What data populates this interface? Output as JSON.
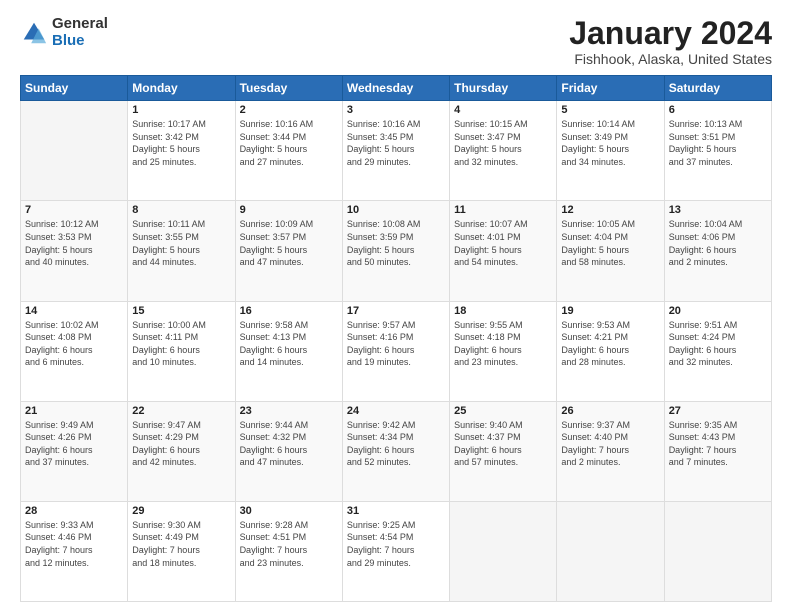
{
  "logo": {
    "general": "General",
    "blue": "Blue"
  },
  "header": {
    "title": "January 2024",
    "subtitle": "Fishhook, Alaska, United States"
  },
  "days_of_week": [
    "Sunday",
    "Monday",
    "Tuesday",
    "Wednesday",
    "Thursday",
    "Friday",
    "Saturday"
  ],
  "weeks": [
    [
      {
        "day": "",
        "info": ""
      },
      {
        "day": "1",
        "info": "Sunrise: 10:17 AM\nSunset: 3:42 PM\nDaylight: 5 hours\nand 25 minutes."
      },
      {
        "day": "2",
        "info": "Sunrise: 10:16 AM\nSunset: 3:44 PM\nDaylight: 5 hours\nand 27 minutes."
      },
      {
        "day": "3",
        "info": "Sunrise: 10:16 AM\nSunset: 3:45 PM\nDaylight: 5 hours\nand 29 minutes."
      },
      {
        "day": "4",
        "info": "Sunrise: 10:15 AM\nSunset: 3:47 PM\nDaylight: 5 hours\nand 32 minutes."
      },
      {
        "day": "5",
        "info": "Sunrise: 10:14 AM\nSunset: 3:49 PM\nDaylight: 5 hours\nand 34 minutes."
      },
      {
        "day": "6",
        "info": "Sunrise: 10:13 AM\nSunset: 3:51 PM\nDaylight: 5 hours\nand 37 minutes."
      }
    ],
    [
      {
        "day": "7",
        "info": "Sunrise: 10:12 AM\nSunset: 3:53 PM\nDaylight: 5 hours\nand 40 minutes."
      },
      {
        "day": "8",
        "info": "Sunrise: 10:11 AM\nSunset: 3:55 PM\nDaylight: 5 hours\nand 44 minutes."
      },
      {
        "day": "9",
        "info": "Sunrise: 10:09 AM\nSunset: 3:57 PM\nDaylight: 5 hours\nand 47 minutes."
      },
      {
        "day": "10",
        "info": "Sunrise: 10:08 AM\nSunset: 3:59 PM\nDaylight: 5 hours\nand 50 minutes."
      },
      {
        "day": "11",
        "info": "Sunrise: 10:07 AM\nSunset: 4:01 PM\nDaylight: 5 hours\nand 54 minutes."
      },
      {
        "day": "12",
        "info": "Sunrise: 10:05 AM\nSunset: 4:04 PM\nDaylight: 5 hours\nand 58 minutes."
      },
      {
        "day": "13",
        "info": "Sunrise: 10:04 AM\nSunset: 4:06 PM\nDaylight: 6 hours\nand 2 minutes."
      }
    ],
    [
      {
        "day": "14",
        "info": "Sunrise: 10:02 AM\nSunset: 4:08 PM\nDaylight: 6 hours\nand 6 minutes."
      },
      {
        "day": "15",
        "info": "Sunrise: 10:00 AM\nSunset: 4:11 PM\nDaylight: 6 hours\nand 10 minutes."
      },
      {
        "day": "16",
        "info": "Sunrise: 9:58 AM\nSunset: 4:13 PM\nDaylight: 6 hours\nand 14 minutes."
      },
      {
        "day": "17",
        "info": "Sunrise: 9:57 AM\nSunset: 4:16 PM\nDaylight: 6 hours\nand 19 minutes."
      },
      {
        "day": "18",
        "info": "Sunrise: 9:55 AM\nSunset: 4:18 PM\nDaylight: 6 hours\nand 23 minutes."
      },
      {
        "day": "19",
        "info": "Sunrise: 9:53 AM\nSunset: 4:21 PM\nDaylight: 6 hours\nand 28 minutes."
      },
      {
        "day": "20",
        "info": "Sunrise: 9:51 AM\nSunset: 4:24 PM\nDaylight: 6 hours\nand 32 minutes."
      }
    ],
    [
      {
        "day": "21",
        "info": "Sunrise: 9:49 AM\nSunset: 4:26 PM\nDaylight: 6 hours\nand 37 minutes."
      },
      {
        "day": "22",
        "info": "Sunrise: 9:47 AM\nSunset: 4:29 PM\nDaylight: 6 hours\nand 42 minutes."
      },
      {
        "day": "23",
        "info": "Sunrise: 9:44 AM\nSunset: 4:32 PM\nDaylight: 6 hours\nand 47 minutes."
      },
      {
        "day": "24",
        "info": "Sunrise: 9:42 AM\nSunset: 4:34 PM\nDaylight: 6 hours\nand 52 minutes."
      },
      {
        "day": "25",
        "info": "Sunrise: 9:40 AM\nSunset: 4:37 PM\nDaylight: 6 hours\nand 57 minutes."
      },
      {
        "day": "26",
        "info": "Sunrise: 9:37 AM\nSunset: 4:40 PM\nDaylight: 7 hours\nand 2 minutes."
      },
      {
        "day": "27",
        "info": "Sunrise: 9:35 AM\nSunset: 4:43 PM\nDaylight: 7 hours\nand 7 minutes."
      }
    ],
    [
      {
        "day": "28",
        "info": "Sunrise: 9:33 AM\nSunset: 4:46 PM\nDaylight: 7 hours\nand 12 minutes."
      },
      {
        "day": "29",
        "info": "Sunrise: 9:30 AM\nSunset: 4:49 PM\nDaylight: 7 hours\nand 18 minutes."
      },
      {
        "day": "30",
        "info": "Sunrise: 9:28 AM\nSunset: 4:51 PM\nDaylight: 7 hours\nand 23 minutes."
      },
      {
        "day": "31",
        "info": "Sunrise: 9:25 AM\nSunset: 4:54 PM\nDaylight: 7 hours\nand 29 minutes."
      },
      {
        "day": "",
        "info": ""
      },
      {
        "day": "",
        "info": ""
      },
      {
        "day": "",
        "info": ""
      }
    ]
  ]
}
